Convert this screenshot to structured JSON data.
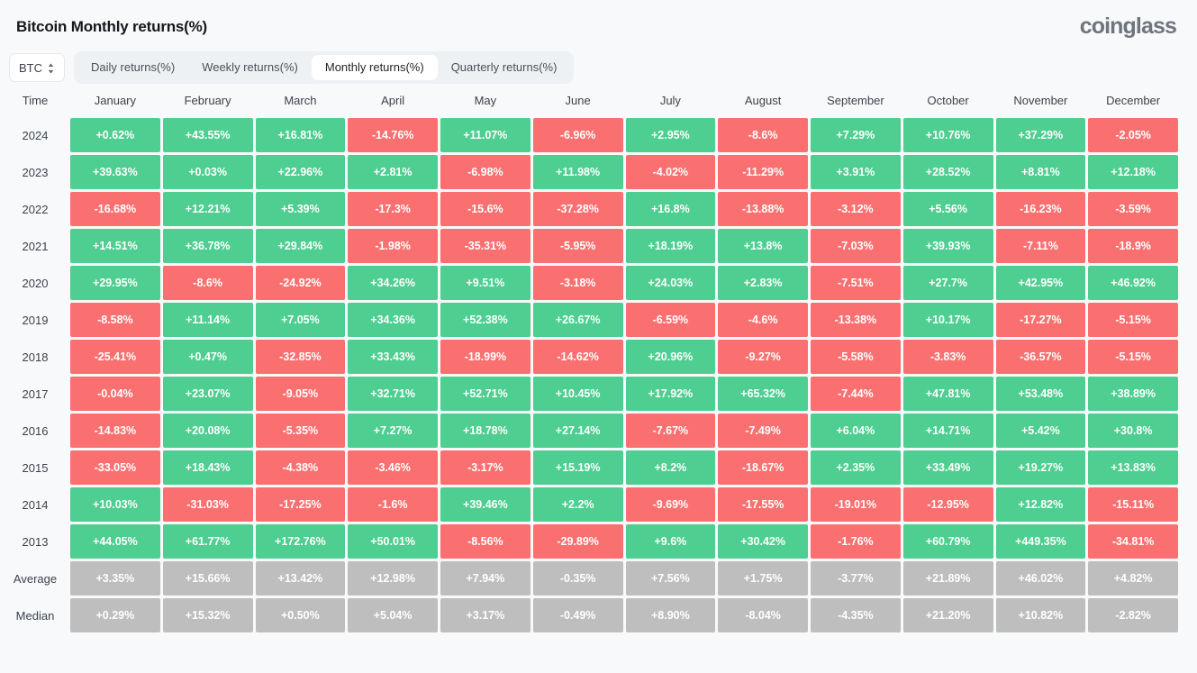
{
  "header": {
    "title": "Bitcoin Monthly returns(%)",
    "brand": "coinglass"
  },
  "controls": {
    "symbol": "BTC",
    "symbol_icon": "up-down-chevron-icon",
    "tabs": [
      {
        "label": "Daily returns(%)",
        "active": false
      },
      {
        "label": "Weekly returns(%)",
        "active": false
      },
      {
        "label": "Monthly returns(%)",
        "active": true
      },
      {
        "label": "Quarterly returns(%)",
        "active": false
      }
    ]
  },
  "colors": {
    "positive": "#4ECE90",
    "negative": "#FA7070",
    "stat": "#BEBEBE",
    "background": "#f8f9fa",
    "tabs_bg": "#eef1f4"
  },
  "chart_data": {
    "type": "heatmap",
    "title": "Bitcoin Monthly returns(%)",
    "xlabel": "",
    "ylabel": "Time",
    "unit": "%",
    "columns": [
      "Time",
      "January",
      "February",
      "March",
      "April",
      "May",
      "June",
      "July",
      "August",
      "September",
      "October",
      "November",
      "December"
    ],
    "categories": [
      "January",
      "February",
      "March",
      "April",
      "May",
      "June",
      "July",
      "August",
      "September",
      "October",
      "November",
      "December"
    ],
    "rows": [
      {
        "label": "2024",
        "kind": "year",
        "values": [
          "+0.62%",
          "+43.55%",
          "+16.81%",
          "-14.76%",
          "+11.07%",
          "-6.96%",
          "+2.95%",
          "-8.6%",
          "+7.29%",
          "+10.76%",
          "+37.29%",
          "-2.05%"
        ]
      },
      {
        "label": "2023",
        "kind": "year",
        "values": [
          "+39.63%",
          "+0.03%",
          "+22.96%",
          "+2.81%",
          "-6.98%",
          "+11.98%",
          "-4.02%",
          "-11.29%",
          "+3.91%",
          "+28.52%",
          "+8.81%",
          "+12.18%"
        ]
      },
      {
        "label": "2022",
        "kind": "year",
        "values": [
          "-16.68%",
          "+12.21%",
          "+5.39%",
          "-17.3%",
          "-15.6%",
          "-37.28%",
          "+16.8%",
          "-13.88%",
          "-3.12%",
          "+5.56%",
          "-16.23%",
          "-3.59%"
        ]
      },
      {
        "label": "2021",
        "kind": "year",
        "values": [
          "+14.51%",
          "+36.78%",
          "+29.84%",
          "-1.98%",
          "-35.31%",
          "-5.95%",
          "+18.19%",
          "+13.8%",
          "-7.03%",
          "+39.93%",
          "-7.11%",
          "-18.9%"
        ]
      },
      {
        "label": "2020",
        "kind": "year",
        "values": [
          "+29.95%",
          "-8.6%",
          "-24.92%",
          "+34.26%",
          "+9.51%",
          "-3.18%",
          "+24.03%",
          "+2.83%",
          "-7.51%",
          "+27.7%",
          "+42.95%",
          "+46.92%"
        ]
      },
      {
        "label": "2019",
        "kind": "year",
        "values": [
          "-8.58%",
          "+11.14%",
          "+7.05%",
          "+34.36%",
          "+52.38%",
          "+26.67%",
          "-6.59%",
          "-4.6%",
          "-13.38%",
          "+10.17%",
          "-17.27%",
          "-5.15%"
        ]
      },
      {
        "label": "2018",
        "kind": "year",
        "values": [
          "-25.41%",
          "+0.47%",
          "-32.85%",
          "+33.43%",
          "-18.99%",
          "-14.62%",
          "+20.96%",
          "-9.27%",
          "-5.58%",
          "-3.83%",
          "-36.57%",
          "-5.15%"
        ]
      },
      {
        "label": "2017",
        "kind": "year",
        "values": [
          "-0.04%",
          "+23.07%",
          "-9.05%",
          "+32.71%",
          "+52.71%",
          "+10.45%",
          "+17.92%",
          "+65.32%",
          "-7.44%",
          "+47.81%",
          "+53.48%",
          "+38.89%"
        ]
      },
      {
        "label": "2016",
        "kind": "year",
        "values": [
          "-14.83%",
          "+20.08%",
          "-5.35%",
          "+7.27%",
          "+18.78%",
          "+27.14%",
          "-7.67%",
          "-7.49%",
          "+6.04%",
          "+14.71%",
          "+5.42%",
          "+30.8%"
        ]
      },
      {
        "label": "2015",
        "kind": "year",
        "values": [
          "-33.05%",
          "+18.43%",
          "-4.38%",
          "-3.46%",
          "-3.17%",
          "+15.19%",
          "+8.2%",
          "-18.67%",
          "+2.35%",
          "+33.49%",
          "+19.27%",
          "+13.83%"
        ]
      },
      {
        "label": "2014",
        "kind": "year",
        "values": [
          "+10.03%",
          "-31.03%",
          "-17.25%",
          "-1.6%",
          "+39.46%",
          "+2.2%",
          "-9.69%",
          "-17.55%",
          "-19.01%",
          "-12.95%",
          "+12.82%",
          "-15.11%"
        ]
      },
      {
        "label": "2013",
        "kind": "year",
        "values": [
          "+44.05%",
          "+61.77%",
          "+172.76%",
          "+50.01%",
          "-8.56%",
          "-29.89%",
          "+9.6%",
          "+30.42%",
          "-1.76%",
          "+60.79%",
          "+449.35%",
          "-34.81%"
        ]
      },
      {
        "label": "Average",
        "kind": "stat",
        "values": [
          "+3.35%",
          "+15.66%",
          "+13.42%",
          "+12.98%",
          "+7.94%",
          "-0.35%",
          "+7.56%",
          "+1.75%",
          "-3.77%",
          "+21.89%",
          "+46.02%",
          "+4.82%"
        ]
      },
      {
        "label": "Median",
        "kind": "stat",
        "values": [
          "+0.29%",
          "+15.32%",
          "+0.50%",
          "+5.04%",
          "+3.17%",
          "-0.49%",
          "+8.90%",
          "-8.04%",
          "-4.35%",
          "+21.20%",
          "+10.82%",
          "-2.82%"
        ]
      }
    ]
  }
}
